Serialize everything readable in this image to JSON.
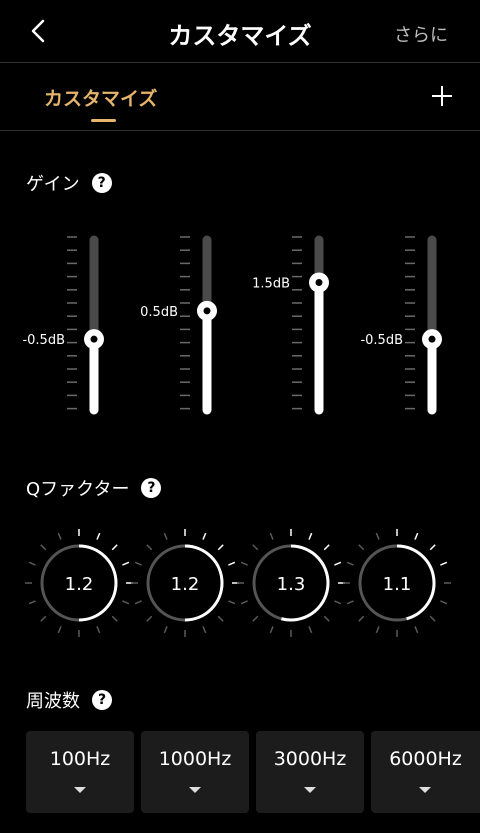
{
  "header": {
    "title": "カスタマイズ",
    "more_label": "さらに"
  },
  "tabs": [
    {
      "label": "カスタマイズ",
      "active": true
    }
  ],
  "colors": {
    "accent": "#e6b56b",
    "background": "#000000",
    "track": "#4a4a4a",
    "fill": "#ffffff"
  },
  "gain": {
    "label": "ゲイン",
    "help": "?",
    "range_db": [
      -3,
      3
    ],
    "sliders": [
      {
        "value": -0.5,
        "label": "-0.5dB"
      },
      {
        "value": 0.5,
        "label": "0.5dB"
      },
      {
        "value": 1.5,
        "label": "1.5dB"
      },
      {
        "value": -0.5,
        "label": "-0.5dB"
      }
    ]
  },
  "q_factor": {
    "label": "Qファクター",
    "help": "?",
    "dials": [
      {
        "value": 1.2,
        "label": "1.2"
      },
      {
        "value": 1.2,
        "label": "1.2"
      },
      {
        "value": 1.3,
        "label": "1.3"
      },
      {
        "value": 1.1,
        "label": "1.1"
      }
    ]
  },
  "frequency": {
    "label": "周波数",
    "help": "?",
    "options": [
      "100Hz",
      "1000Hz",
      "3000Hz",
      "6000Hz"
    ]
  }
}
